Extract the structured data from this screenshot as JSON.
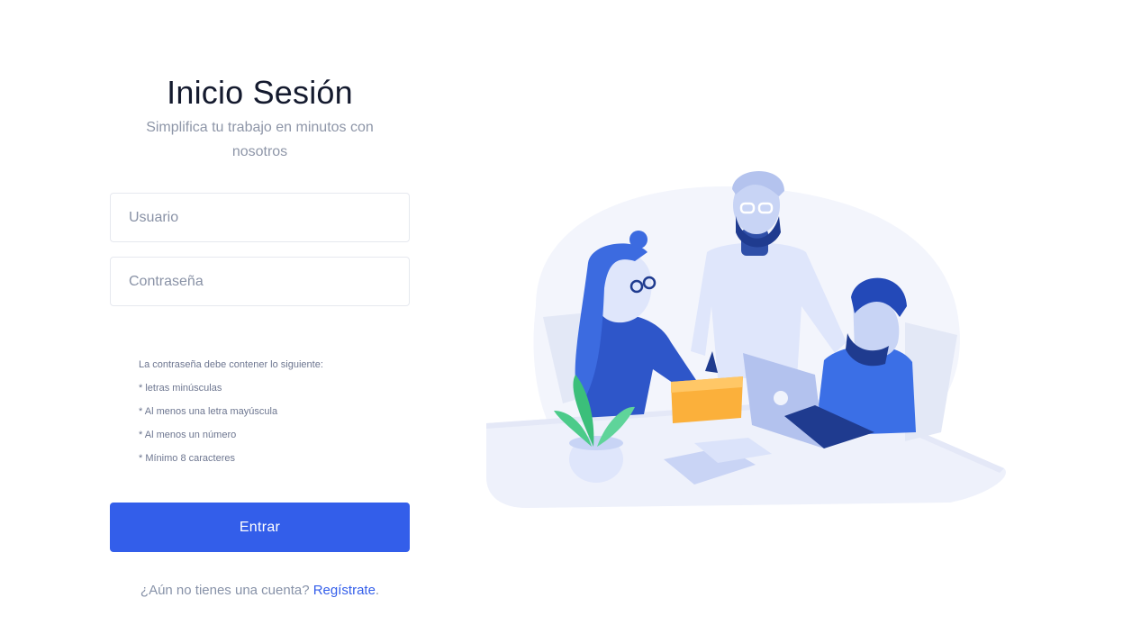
{
  "header": {
    "title": "Inicio Sesión",
    "subtitle": "Simplifica tu trabajo en minutos con nosotros"
  },
  "form": {
    "username_placeholder": "Usuario",
    "password_placeholder": "Contraseña",
    "submit_label": "Entrar"
  },
  "password_rules": {
    "intro": "La contraseña debe contener lo siguiente:",
    "items": [
      "* letras minúsculas",
      "* Al menos una letra mayúscula",
      "* Al menos un número",
      "* Mínimo 8 caracteres"
    ]
  },
  "signup": {
    "prompt": "¿Aún no tienes una cuenta?",
    "link_label": "Regístrate",
    "suffix": "."
  },
  "colors": {
    "primary": "#335eea",
    "title": "#141a2e",
    "muted": "#8e96a8"
  }
}
